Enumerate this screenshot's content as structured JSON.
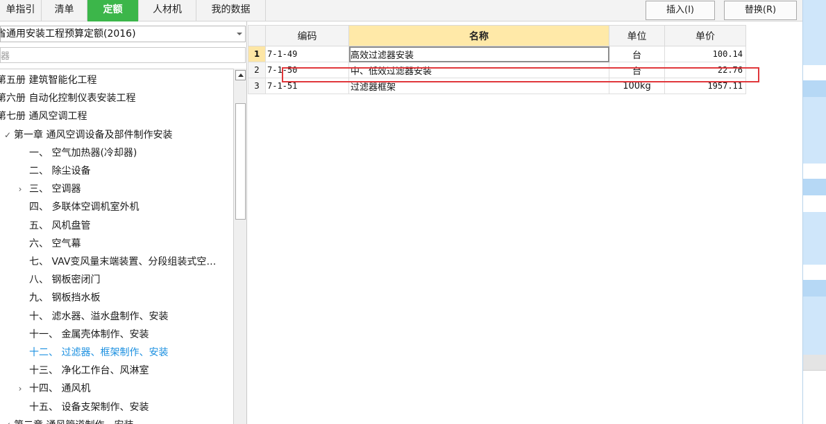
{
  "tabs": [
    {
      "label": "单指引",
      "active": false
    },
    {
      "label": "清单",
      "active": false
    },
    {
      "label": "定额",
      "active": true
    },
    {
      "label": "人材机",
      "active": false
    },
    {
      "label": "我的数据",
      "active": false
    }
  ],
  "actions": {
    "insert_label": "插入(I)",
    "replace_label": "替换(R)"
  },
  "library": {
    "selected": "省通用安装工程预算定额(2016)"
  },
  "search": {
    "value": "器"
  },
  "tree": [
    {
      "label": "第五册 建筑智能化工程",
      "arrow": "",
      "level": 0
    },
    {
      "label": "第六册 自动化控制仪表安装工程",
      "arrow": "",
      "level": 0
    },
    {
      "label": "第七册 通风空调工程",
      "arrow": "",
      "level": 0
    },
    {
      "label": "第一章 通风空调设备及部件制作安装",
      "arrow": "✓",
      "level": 1
    },
    {
      "label": "一、 空气加热器(冷却器)",
      "arrow": "",
      "level": 2
    },
    {
      "label": "二、 除尘设备",
      "arrow": "",
      "level": 2
    },
    {
      "label": "三、 空调器",
      "arrow": "›",
      "level": 2
    },
    {
      "label": "四、 多联体空调机室外机",
      "arrow": "",
      "level": 2
    },
    {
      "label": "五、 风机盘管",
      "arrow": "",
      "level": 2
    },
    {
      "label": "六、 空气幕",
      "arrow": "",
      "level": 2
    },
    {
      "label": "七、 VAV变风量末端装置、分段组装式空…",
      "arrow": "",
      "level": 2
    },
    {
      "label": "八、 钢板密闭门",
      "arrow": "",
      "level": 2
    },
    {
      "label": "九、 钢板挡水板",
      "arrow": "",
      "level": 2
    },
    {
      "label": "十、 滤水器、溢水盘制作、安装",
      "arrow": "",
      "level": 2
    },
    {
      "label": "十一、 金属壳体制作、安装",
      "arrow": "",
      "level": 2
    },
    {
      "label": "十二、 过滤器、框架制作、安装",
      "arrow": "",
      "level": 2,
      "selected": true
    },
    {
      "label": "十三、 净化工作台、风淋室",
      "arrow": "",
      "level": 2
    },
    {
      "label": "十四、 通风机",
      "arrow": "›",
      "level": 2
    },
    {
      "label": "十五、 设备支架制作、安装",
      "arrow": "",
      "level": 2
    },
    {
      "label": "第二章 通风管道制作、安装",
      "arrow": "✓",
      "level": 1
    }
  ],
  "grid": {
    "headers": [
      "编码",
      "名称",
      "单位",
      "单价"
    ],
    "rows": [
      {
        "num": "1",
        "code": "7-1-49",
        "name": "高效过滤器安装",
        "unit": "台",
        "price": "100.14"
      },
      {
        "num": "2",
        "code": "7-1-50",
        "name": "中、低效过滤器安装",
        "unit": "台",
        "price": "22.76"
      },
      {
        "num": "3",
        "code": "7-1-51",
        "name": "过滤器框架",
        "unit": "100kg",
        "price": "1957.11"
      }
    ]
  }
}
